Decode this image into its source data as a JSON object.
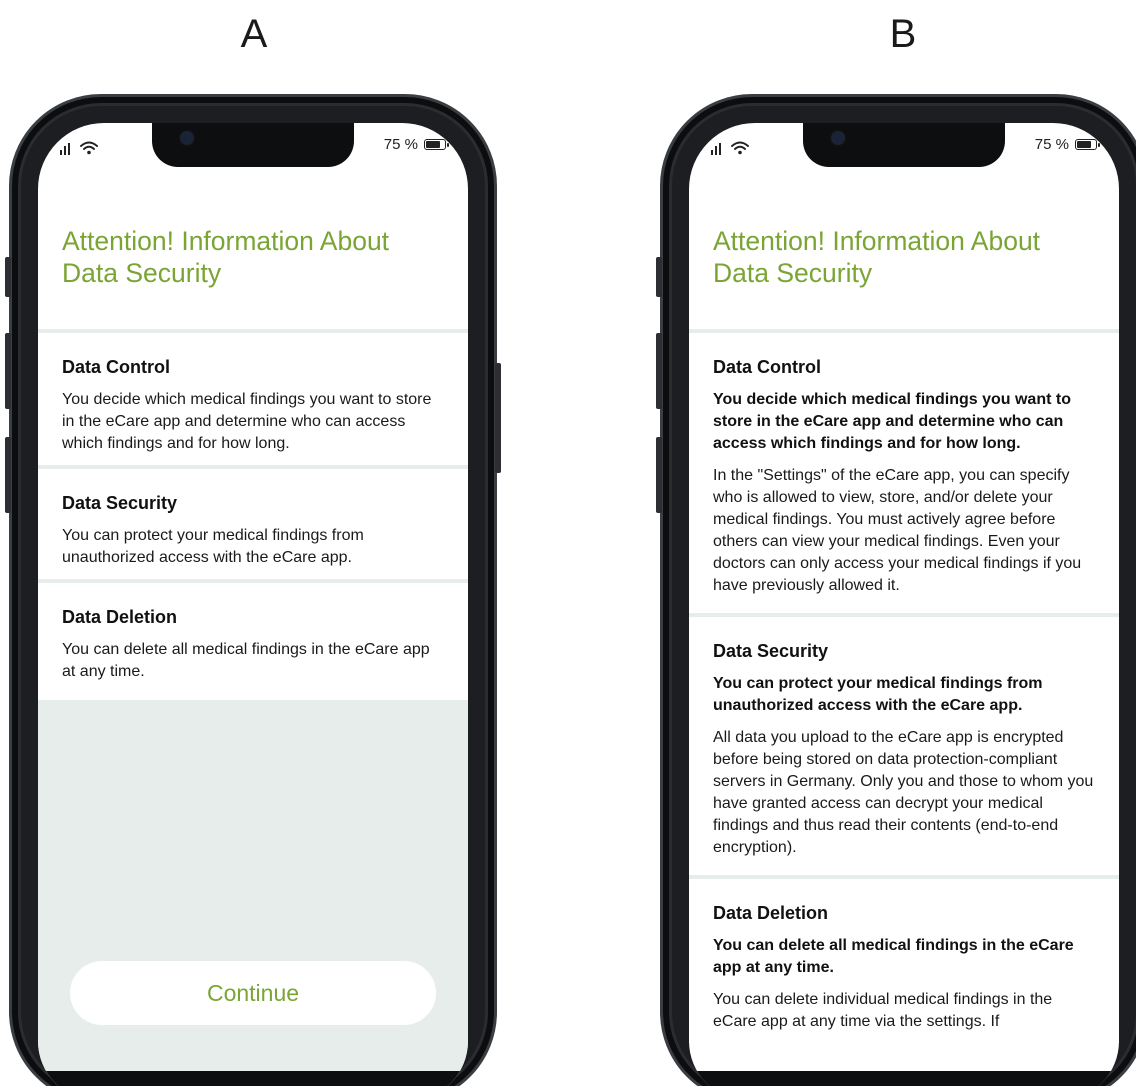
{
  "panels": {
    "a_label": "A",
    "b_label": "B"
  },
  "status_bar": {
    "battery_percent": "75 %",
    "battery_level": 0.75
  },
  "screen_a": {
    "title": "Attention! Information About Data Security",
    "sections": [
      {
        "heading": "Data Control",
        "body": "You decide which medical findings you want to store in the eCare app and determine who can access which findings and for how long."
      },
      {
        "heading": "Data Security",
        "body": "You can protect your medical findings from unauthorized access with the eCare app."
      },
      {
        "heading": "Data Deletion",
        "body": "You can delete all medical findings in the eCare app at any time."
      }
    ],
    "continue_label": "Continue"
  },
  "screen_b": {
    "title": "Attention! Information About Data Security",
    "sections": [
      {
        "heading": "Data Control",
        "lead": "You decide which medical findings you want to store in the eCare app and determine who can access which findings and for how long.",
        "body": "In the \"Settings\" of the eCare app, you can specify who is allowed to view, store, and/or delete your medical findings. You must actively agree before others can view your medical findings. Even your doctors can only access your medical findings if you have previously allowed it."
      },
      {
        "heading": "Data Security",
        "lead": "You can protect your medical findings from unauthorized access with the eCare app.",
        "body": "All data you upload to the eCare app is encrypted before being stored on data protection-compliant servers in Germany. Only you and those to whom you have granted access can decrypt your medical findings and thus read their contents (end-to-end encryption)."
      },
      {
        "heading": "Data Deletion",
        "lead": "You can delete all medical findings in the eCare app at any time.",
        "body": "You can delete individual medical findings in the eCare app at any time via the settings. If"
      }
    ]
  },
  "icons": {
    "signal": "signal-icon",
    "wifi": "wifi-icon",
    "battery": "battery-icon"
  }
}
